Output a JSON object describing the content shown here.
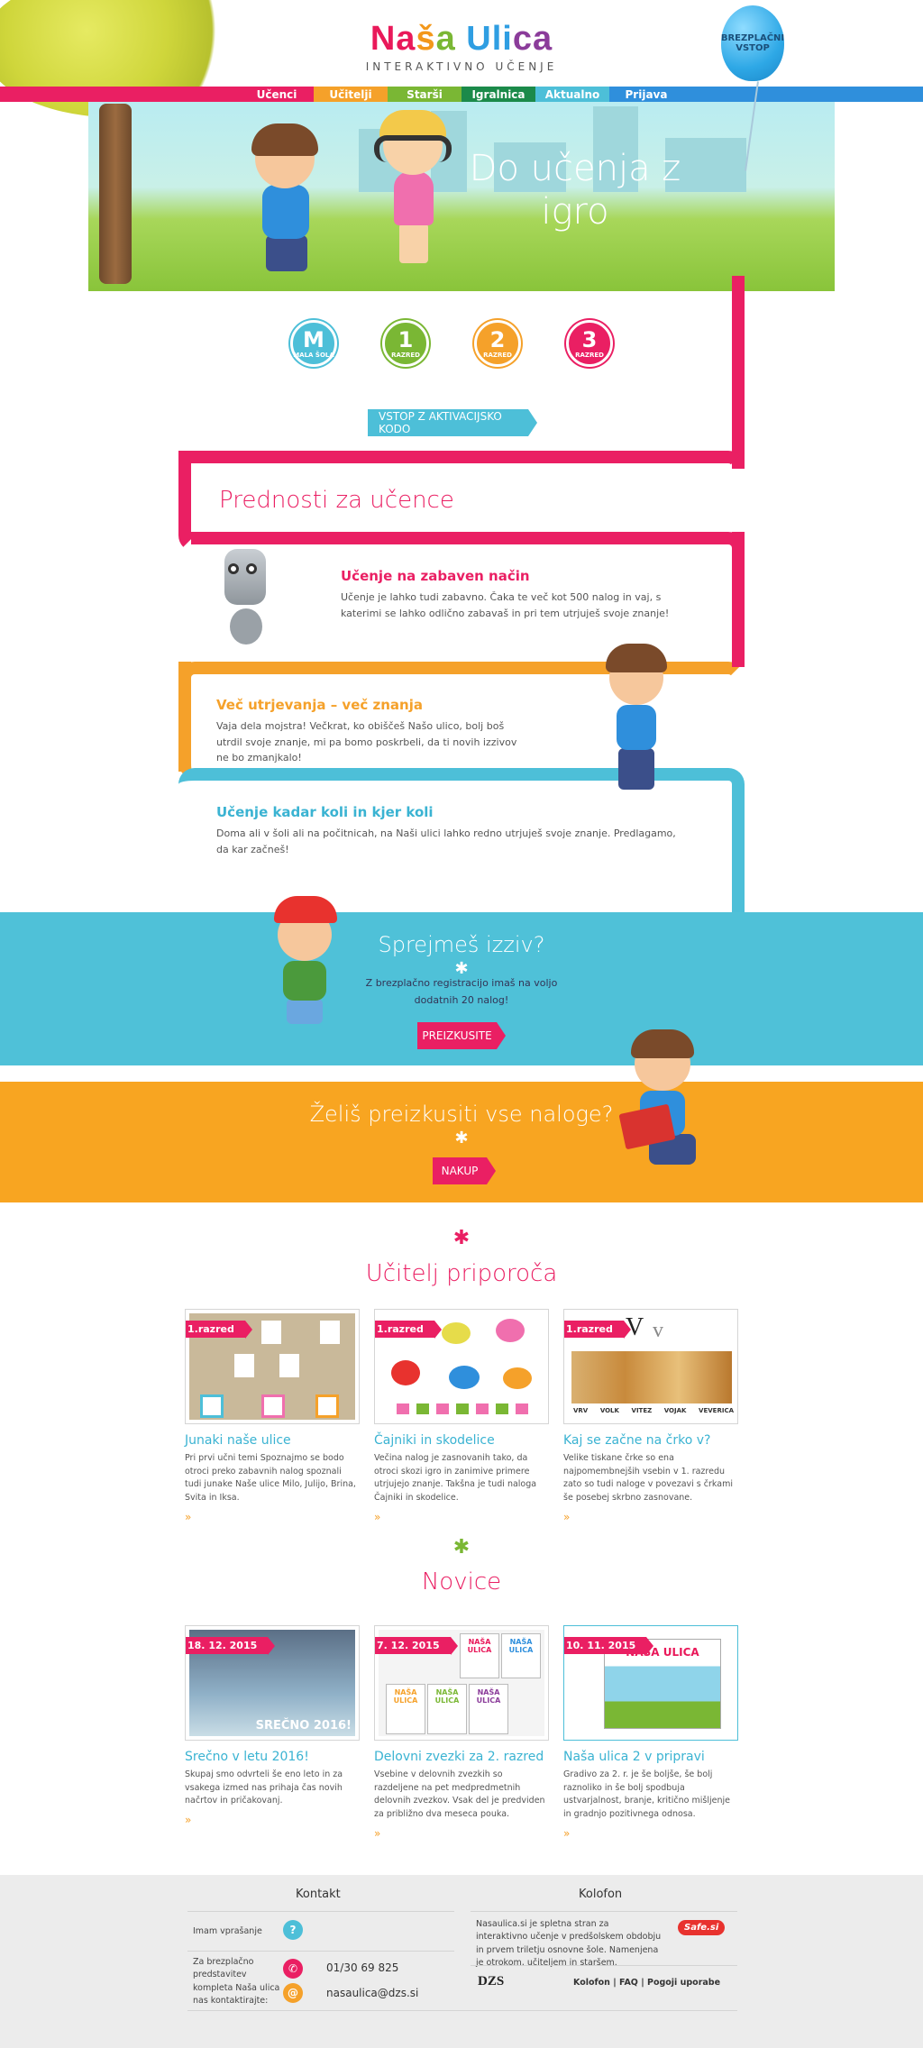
{
  "logo": {
    "letters": [
      "Na",
      "š",
      "a ",
      "Uli",
      "ca"
    ],
    "subtitle": "INTERAKTIVNO UČENJE"
  },
  "balloon": {
    "label": "BREZPLAČNI VSTOP"
  },
  "nav": [
    {
      "label": "Učenci",
      "color": "#ea1f63"
    },
    {
      "label": "Učitelji",
      "color": "#f5a12a"
    },
    {
      "label": "Starši",
      "color": "#7ab734"
    },
    {
      "label": "Igralnica",
      "color": "#1b8a4a"
    },
    {
      "label": "Aktualno",
      "color": "#4dbfd8"
    },
    {
      "label": "Prijava",
      "color": "#2f8fdc"
    }
  ],
  "hero": {
    "title": "Do učenja z igro"
  },
  "badges": [
    {
      "num": "M",
      "label": "MALA ŠOLA",
      "color": "#4dbfd8"
    },
    {
      "num": "1",
      "label": "RAZRED",
      "color": "#7ab734"
    },
    {
      "num": "2",
      "label": "RAZRED",
      "color": "#f5a12a"
    },
    {
      "num": "3",
      "label": "RAZRED",
      "color": "#ea1f63"
    }
  ],
  "activation_button": "VSTOP Z AKTIVACIJSKO KODO",
  "advantages": {
    "title": "Prednosti za učence",
    "items": [
      {
        "title": "Učenje na zabaven način",
        "text": "Učenje je lahko tudi zabavno. Čaka te več kot 500 nalog in vaj, s katerimi se lahko odlično zabavaš in pri tem utrjuješ svoje znanje!",
        "color": "#ea1f63"
      },
      {
        "title": "Več utrjevanja – več znanja",
        "text": "Vaja dela mojstra! Večkrat, ko obiščeš Našo ulico, bolj boš utrdil svoje znanje, mi pa bomo poskrbeli, da ti novih izzivov ne bo zmanjkalo!",
        "color": "#f5a12a"
      },
      {
        "title": "Učenje kadar koli in kjer koli",
        "text": "Doma ali v šoli ali na počitnicah, na Naši ulici lahko redno utrjuješ svoje znanje. Predlagamo, da kar začneš!",
        "color": "#3ab3d2"
      }
    ]
  },
  "challenge": {
    "title": "Sprejmeš izziv?",
    "star": "✱",
    "text": "Z brezplačno registracijo imaš na voljo dodatnih 20 nalog!",
    "button": "PREIZKUSITE"
  },
  "purchase": {
    "title": "Želiš preizkusiti vse naloge?",
    "star": "✱",
    "button": "NAKUP"
  },
  "teacher": {
    "title": "Učitelj priporoča",
    "cards": [
      {
        "tag": "1.razred",
        "title": "Junaki naše ulice",
        "text": "Pri prvi učni temi Spoznajmo se bodo otroci preko zabavnih nalog spoznali tudi junake Naše ulice Milo, Julijo, Brina, Svita in Iksa.",
        "more": "»"
      },
      {
        "tag": "1.razred",
        "title": "Čajniki in skodelice",
        "text": "Večina nalog je zasnovanih tako, da otroci skozi igro in zanimive primere utrjujejo znanje. Takšna je tudi naloga Čajniki in skodelice.",
        "more": "»"
      },
      {
        "tag": "1.razred",
        "title": "Kaj se začne na črko v?",
        "text": "Velike tiskane črke so ena najpomembnejših vsebin v 1. razredu zato so tudi naloge v povezavi s črkami še posebej skrbno zasnovane.",
        "more": "»",
        "letters": [
          "V",
          "v"
        ],
        "words": [
          "VRV",
          "VOLK",
          "VITEZ",
          "VOJAK",
          "VEVERICA"
        ]
      }
    ]
  },
  "news": {
    "title": "Novice",
    "cards": [
      {
        "tag": "18. 12. 2015",
        "title": "Srečno v letu 2016!",
        "text": "Skupaj smo odvrteli še eno leto in za vsakega izmed nas prihaja čas novih načrtov in pričakovanj.",
        "more": "»",
        "caption": "SREČNO 2016!"
      },
      {
        "tag": "7. 12. 2015",
        "title": "Delovni zvezki za 2. razred",
        "text": "Vsebine v delovnih zvezkih so razdeljene na pet medpredmetnih delovnih zvezkov. Vsak del je predviden za približno dva meseca pouka.",
        "more": "»",
        "book_label": "NAŠA ULICA"
      },
      {
        "tag": "10. 11. 2015",
        "title": "Naša ulica 2 v pripravi",
        "text": "Gradivo za 2. r. je še boljše, še bolj raznoliko in še bolj spodbuja ustvarjalnost, branje, kritično mišljenje in gradnjo pozitivnega odnosa.",
        "more": "»",
        "box_label": "NAŠA ULICA"
      }
    ]
  },
  "footer": {
    "contact_title": "Kontakt",
    "ask_label": "Imam vprašanje",
    "ask_icon": "?",
    "presenter_label": "Za brezplačno predstavitev kompleta Naša ulica nas kontaktirajte:",
    "phone": "01/30 69 825",
    "email": "nasaulica@dzs.si",
    "colophon_title": "Kolofon",
    "colophon_text": "Nasaulica.si je spletna stran za interaktivno učenje v predšolskem obdobju in prvem triletju osnovne šole. Namenjena je otrokom, učiteljem in staršem.",
    "safe_badge": "Safe.si",
    "publisher": "DZS",
    "links": [
      "Kolofon",
      "FAQ",
      "Pogoji uporabe"
    ],
    "separator": "|"
  }
}
